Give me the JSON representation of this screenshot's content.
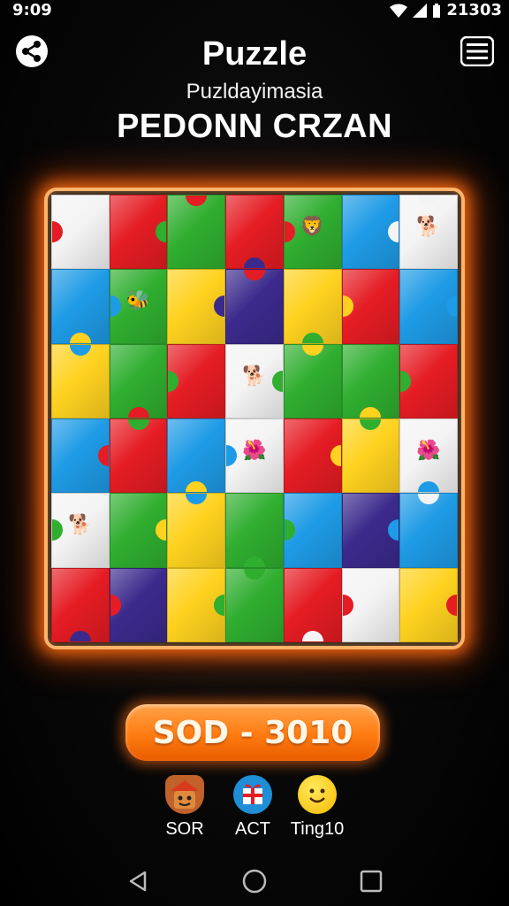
{
  "status_bar": {
    "time": "9:09",
    "clock": "21303"
  },
  "header": {
    "title": "Puzzle",
    "subtitle": "Puzldayimasia",
    "headline": "PEDONN CRZAN"
  },
  "colors": {
    "red": "#e51c23",
    "yellow": "#ffd21f",
    "green": "#2fae2f",
    "blue": "#1e9be6",
    "purple": "#3b2a8c",
    "white": "#f4f4f4",
    "accent": "#ff7b10"
  },
  "board": {
    "grid": [
      [
        "white",
        "red",
        "green",
        "red",
        "green",
        "blue",
        "white"
      ],
      [
        "blue",
        "green",
        "yellow",
        "purple",
        "yellow",
        "red",
        "blue"
      ],
      [
        "yellow",
        "green",
        "red",
        "white",
        "green",
        "green",
        "red"
      ],
      [
        "blue",
        "red",
        "blue",
        "white",
        "red",
        "yellow",
        "white"
      ],
      [
        "white",
        "green",
        "yellow",
        "green",
        "blue",
        "purple",
        "blue"
      ],
      [
        "red",
        "purple",
        "yellow",
        "green",
        "red",
        "white",
        "yellow"
      ]
    ]
  },
  "score_button": {
    "label": "SOD - 3010"
  },
  "bottom_actions": [
    {
      "label": "SOR",
      "icon": "house-face-icon"
    },
    {
      "label": "ACT",
      "icon": "gift-box-icon"
    },
    {
      "label": "Ting10",
      "icon": "smiley-icon"
    }
  ],
  "nav": {
    "back": "back-icon",
    "home": "home-icon",
    "recents": "recents-icon"
  }
}
